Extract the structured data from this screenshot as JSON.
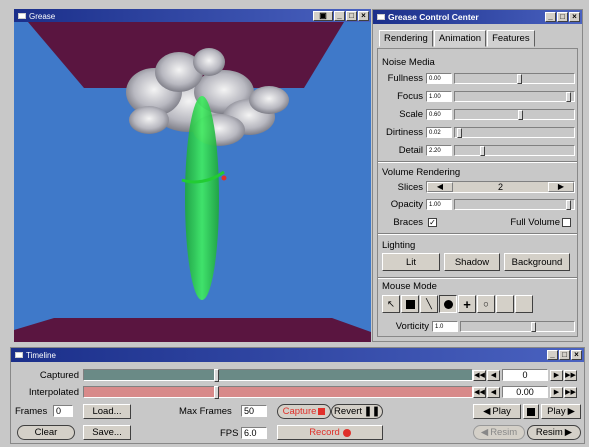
{
  "viewport": {
    "title": "Grease",
    "colors": {
      "sky": "#3f79c9",
      "floor": "#5a1540",
      "ceiling": "#5a1540",
      "ellipsoid": "#22dd44"
    }
  },
  "control_center": {
    "title": "Grease Control Center",
    "tabs": [
      "Rendering",
      "Animation",
      "Features"
    ],
    "noise_media": {
      "title": "Noise Media",
      "rows": [
        {
          "label": "Fullness",
          "value": "0.00",
          "level": 0.55
        },
        {
          "label": "Focus",
          "value": "1.00",
          "level": 0.98
        },
        {
          "label": "Scale",
          "value": "0.60",
          "level": 0.56
        },
        {
          "label": "Dirtiness",
          "value": "0.02",
          "level": 0.02
        },
        {
          "label": "Detail",
          "value": "2.20",
          "level": 0.22
        }
      ]
    },
    "volume_rendering": {
      "title": "Volume Rendering",
      "slices_label": "Slices",
      "slices_value": "2",
      "opacity_label": "Opacity",
      "opacity_value": "1.00",
      "opacity_level": 0.98,
      "braces_label": "Braces",
      "braces_checked": "✓",
      "full_volume_label": "Full Volume"
    },
    "lighting": {
      "title": "Lighting",
      "buttons": [
        "Lit",
        "Shadow",
        "Background"
      ]
    },
    "mouse_mode": {
      "title": "Mouse Mode",
      "vorticity_label": "Vorticity",
      "vorticity_value": "1.0",
      "vorticity_level": 0.65
    }
  },
  "timeline": {
    "title": "Timeline",
    "captured_label": "Captured",
    "interpolated_label": "Interpolated",
    "captured_level": 0.34,
    "interpolated_level": 0.34,
    "captured_value": "0",
    "interpolated_value": "0.00",
    "frames_label": "Frames",
    "frames_value": "0",
    "load_label": "Load...",
    "clear_label": "Clear",
    "save_label": "Save...",
    "max_frames_label": "Max Frames",
    "max_frames_value": "50",
    "fps_label": "FPS",
    "fps_value": "6.0",
    "capture_label": "Capture",
    "revert_label": "Revert",
    "record_label": "Record",
    "play_back_label": "Play",
    "play_fwd_label": "Play",
    "resim_back_label": "Resim",
    "resim_fwd_label": "Resim",
    "colors": {
      "captured_bar": "#6a8a86",
      "interpolated_bar": "#d88a8a",
      "record": "#e0302a"
    }
  }
}
